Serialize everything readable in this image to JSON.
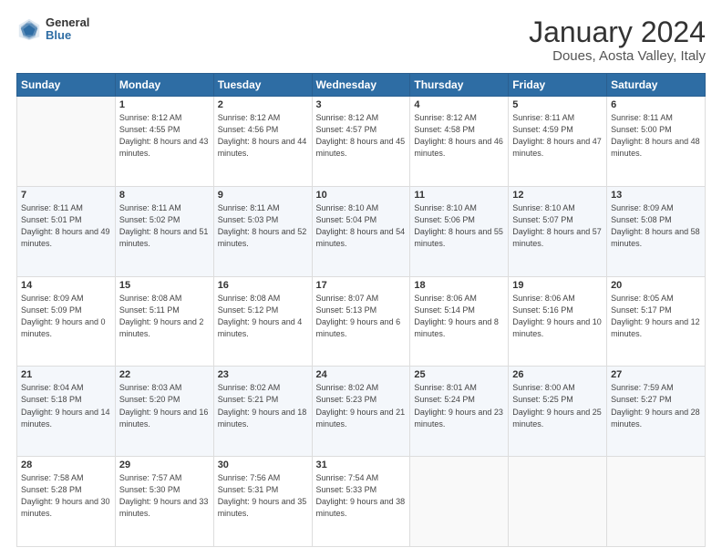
{
  "header": {
    "logo": {
      "general": "General",
      "blue": "Blue"
    },
    "title": "January 2024",
    "subtitle": "Doues, Aosta Valley, Italy"
  },
  "calendar": {
    "days_of_week": [
      "Sunday",
      "Monday",
      "Tuesday",
      "Wednesday",
      "Thursday",
      "Friday",
      "Saturday"
    ],
    "weeks": [
      [
        {
          "day": "",
          "sunrise": "",
          "sunset": "",
          "daylight": ""
        },
        {
          "day": "1",
          "sunrise": "Sunrise: 8:12 AM",
          "sunset": "Sunset: 4:55 PM",
          "daylight": "Daylight: 8 hours and 43 minutes."
        },
        {
          "day": "2",
          "sunrise": "Sunrise: 8:12 AM",
          "sunset": "Sunset: 4:56 PM",
          "daylight": "Daylight: 8 hours and 44 minutes."
        },
        {
          "day": "3",
          "sunrise": "Sunrise: 8:12 AM",
          "sunset": "Sunset: 4:57 PM",
          "daylight": "Daylight: 8 hours and 45 minutes."
        },
        {
          "day": "4",
          "sunrise": "Sunrise: 8:12 AM",
          "sunset": "Sunset: 4:58 PM",
          "daylight": "Daylight: 8 hours and 46 minutes."
        },
        {
          "day": "5",
          "sunrise": "Sunrise: 8:11 AM",
          "sunset": "Sunset: 4:59 PM",
          "daylight": "Daylight: 8 hours and 47 minutes."
        },
        {
          "day": "6",
          "sunrise": "Sunrise: 8:11 AM",
          "sunset": "Sunset: 5:00 PM",
          "daylight": "Daylight: 8 hours and 48 minutes."
        }
      ],
      [
        {
          "day": "7",
          "sunrise": "Sunrise: 8:11 AM",
          "sunset": "Sunset: 5:01 PM",
          "daylight": "Daylight: 8 hours and 49 minutes."
        },
        {
          "day": "8",
          "sunrise": "Sunrise: 8:11 AM",
          "sunset": "Sunset: 5:02 PM",
          "daylight": "Daylight: 8 hours and 51 minutes."
        },
        {
          "day": "9",
          "sunrise": "Sunrise: 8:11 AM",
          "sunset": "Sunset: 5:03 PM",
          "daylight": "Daylight: 8 hours and 52 minutes."
        },
        {
          "day": "10",
          "sunrise": "Sunrise: 8:10 AM",
          "sunset": "Sunset: 5:04 PM",
          "daylight": "Daylight: 8 hours and 54 minutes."
        },
        {
          "day": "11",
          "sunrise": "Sunrise: 8:10 AM",
          "sunset": "Sunset: 5:06 PM",
          "daylight": "Daylight: 8 hours and 55 minutes."
        },
        {
          "day": "12",
          "sunrise": "Sunrise: 8:10 AM",
          "sunset": "Sunset: 5:07 PM",
          "daylight": "Daylight: 8 hours and 57 minutes."
        },
        {
          "day": "13",
          "sunrise": "Sunrise: 8:09 AM",
          "sunset": "Sunset: 5:08 PM",
          "daylight": "Daylight: 8 hours and 58 minutes."
        }
      ],
      [
        {
          "day": "14",
          "sunrise": "Sunrise: 8:09 AM",
          "sunset": "Sunset: 5:09 PM",
          "daylight": "Daylight: 9 hours and 0 minutes."
        },
        {
          "day": "15",
          "sunrise": "Sunrise: 8:08 AM",
          "sunset": "Sunset: 5:11 PM",
          "daylight": "Daylight: 9 hours and 2 minutes."
        },
        {
          "day": "16",
          "sunrise": "Sunrise: 8:08 AM",
          "sunset": "Sunset: 5:12 PM",
          "daylight": "Daylight: 9 hours and 4 minutes."
        },
        {
          "day": "17",
          "sunrise": "Sunrise: 8:07 AM",
          "sunset": "Sunset: 5:13 PM",
          "daylight": "Daylight: 9 hours and 6 minutes."
        },
        {
          "day": "18",
          "sunrise": "Sunrise: 8:06 AM",
          "sunset": "Sunset: 5:14 PM",
          "daylight": "Daylight: 9 hours and 8 minutes."
        },
        {
          "day": "19",
          "sunrise": "Sunrise: 8:06 AM",
          "sunset": "Sunset: 5:16 PM",
          "daylight": "Daylight: 9 hours and 10 minutes."
        },
        {
          "day": "20",
          "sunrise": "Sunrise: 8:05 AM",
          "sunset": "Sunset: 5:17 PM",
          "daylight": "Daylight: 9 hours and 12 minutes."
        }
      ],
      [
        {
          "day": "21",
          "sunrise": "Sunrise: 8:04 AM",
          "sunset": "Sunset: 5:18 PM",
          "daylight": "Daylight: 9 hours and 14 minutes."
        },
        {
          "day": "22",
          "sunrise": "Sunrise: 8:03 AM",
          "sunset": "Sunset: 5:20 PM",
          "daylight": "Daylight: 9 hours and 16 minutes."
        },
        {
          "day": "23",
          "sunrise": "Sunrise: 8:02 AM",
          "sunset": "Sunset: 5:21 PM",
          "daylight": "Daylight: 9 hours and 18 minutes."
        },
        {
          "day": "24",
          "sunrise": "Sunrise: 8:02 AM",
          "sunset": "Sunset: 5:23 PM",
          "daylight": "Daylight: 9 hours and 21 minutes."
        },
        {
          "day": "25",
          "sunrise": "Sunrise: 8:01 AM",
          "sunset": "Sunset: 5:24 PM",
          "daylight": "Daylight: 9 hours and 23 minutes."
        },
        {
          "day": "26",
          "sunrise": "Sunrise: 8:00 AM",
          "sunset": "Sunset: 5:25 PM",
          "daylight": "Daylight: 9 hours and 25 minutes."
        },
        {
          "day": "27",
          "sunrise": "Sunrise: 7:59 AM",
          "sunset": "Sunset: 5:27 PM",
          "daylight": "Daylight: 9 hours and 28 minutes."
        }
      ],
      [
        {
          "day": "28",
          "sunrise": "Sunrise: 7:58 AM",
          "sunset": "Sunset: 5:28 PM",
          "daylight": "Daylight: 9 hours and 30 minutes."
        },
        {
          "day": "29",
          "sunrise": "Sunrise: 7:57 AM",
          "sunset": "Sunset: 5:30 PM",
          "daylight": "Daylight: 9 hours and 33 minutes."
        },
        {
          "day": "30",
          "sunrise": "Sunrise: 7:56 AM",
          "sunset": "Sunset: 5:31 PM",
          "daylight": "Daylight: 9 hours and 35 minutes."
        },
        {
          "day": "31",
          "sunrise": "Sunrise: 7:54 AM",
          "sunset": "Sunset: 5:33 PM",
          "daylight": "Daylight: 9 hours and 38 minutes."
        },
        {
          "day": "",
          "sunrise": "",
          "sunset": "",
          "daylight": ""
        },
        {
          "day": "",
          "sunrise": "",
          "sunset": "",
          "daylight": ""
        },
        {
          "day": "",
          "sunrise": "",
          "sunset": "",
          "daylight": ""
        }
      ]
    ]
  }
}
